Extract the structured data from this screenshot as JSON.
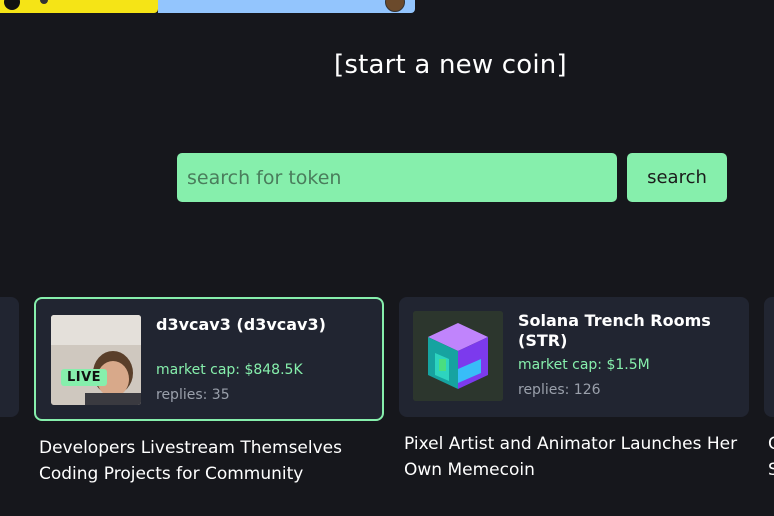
{
  "header": {
    "start_coin_label": "[start a new coin]"
  },
  "search": {
    "placeholder": "search for token",
    "button_label": "search"
  },
  "cards": [
    {
      "title": "d3vcav3 (d3vcav3)",
      "market_cap": "market cap: $848.5K",
      "replies": "replies: 35",
      "badge": "LIVE",
      "description": "Developers Livestream Themselves Coding Projects for Community"
    },
    {
      "title": "Solana Trench Rooms (STR)",
      "market_cap": "market cap: $1.5M",
      "replies": "replies: 126",
      "description": "Pixel Artist and Animator Launches Her Own Memecoin"
    }
  ],
  "edge_card_text": "C S",
  "colors": {
    "background": "#16171c",
    "accent_green": "#86efac",
    "card_bg": "#212531",
    "banner_yellow": "#f5e416",
    "banner_blue": "#93c5fd"
  }
}
